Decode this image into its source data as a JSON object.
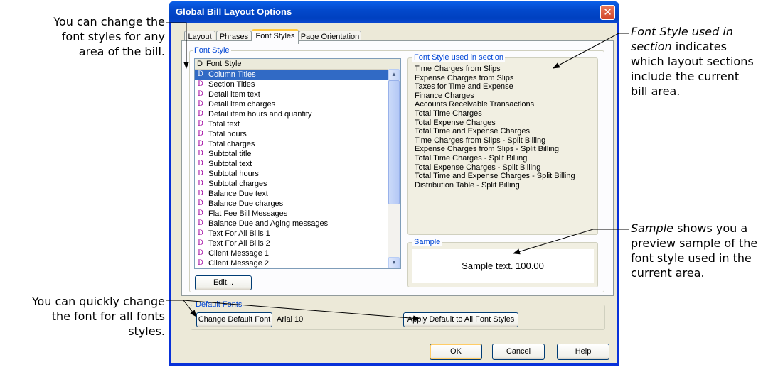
{
  "callouts": {
    "font_styles_any_area": [
      "You can change the",
      "font styles for any",
      "area of the bill."
    ],
    "quick_change": [
      "You can quickly change",
      "the font for all fonts",
      "styles."
    ],
    "font_style_used_em": "Font Style used in",
    "font_style_used_em2": "section",
    "font_style_used_rest": [
      " indicates",
      "which layout sections",
      "include the current",
      "bill area."
    ],
    "sample_em": "Sample",
    "sample_rest": [
      " shows you a",
      "preview sample of the",
      "font style used in the",
      "current area."
    ]
  },
  "dialog": {
    "title": "Global Bill Layout Options",
    "close_glyph": "✕",
    "tabs": [
      "Layout",
      "Phrases",
      "Font Styles",
      "Page Orientation"
    ],
    "active_tab": "Font Styles"
  },
  "font_style_group": {
    "label": "Font Style",
    "header_d": "D",
    "header_label": "Font Style",
    "item_marker": "D",
    "items": [
      "Column Titles",
      "Section Titles",
      "Detail item text",
      "Detail item charges",
      "Detail item hours and quantity",
      "Total text",
      "Total hours",
      "Total charges",
      "Subtotal title",
      "Subtotal text",
      "Subtotal hours",
      "Subtotal charges",
      "Balance Due text",
      "Balance Due charges",
      "Flat Fee Bill Messages",
      "Balance Due and Aging messages",
      "Text For All Bills 1",
      "Text For All Bills 2",
      "Client Message 1",
      "Client Message 2"
    ],
    "selected_index": 0,
    "edit_button": "Edit..."
  },
  "used_in_section": {
    "label": "Font Style used in section",
    "items": [
      "Time Charges from Slips",
      "Expense Charges from Slips",
      "Taxes for Time and Expense",
      "Finance Charges",
      "Accounts Receivable Transactions",
      "Total Time Charges",
      "Total Expense Charges",
      "Total Time and Expense Charges",
      "Time Charges from Slips - Split Billing",
      "Expense Charges from Slips - Split Billing",
      "Total Time Charges - Split Billing",
      "Total Expense Charges - Split Billing",
      "Total Time and Expense Charges - Split Billing",
      "Distribution Table - Split Billing"
    ]
  },
  "sample": {
    "label": "Sample",
    "text": "Sample text. 100.00"
  },
  "default_fonts": {
    "label": "Default Fonts",
    "change_button": "Change Default Font",
    "font_name": "Arial 10",
    "apply_button": "Apply Default to All Font Styles"
  },
  "buttons": {
    "ok": "OK",
    "cancel": "Cancel",
    "help": "Help"
  }
}
